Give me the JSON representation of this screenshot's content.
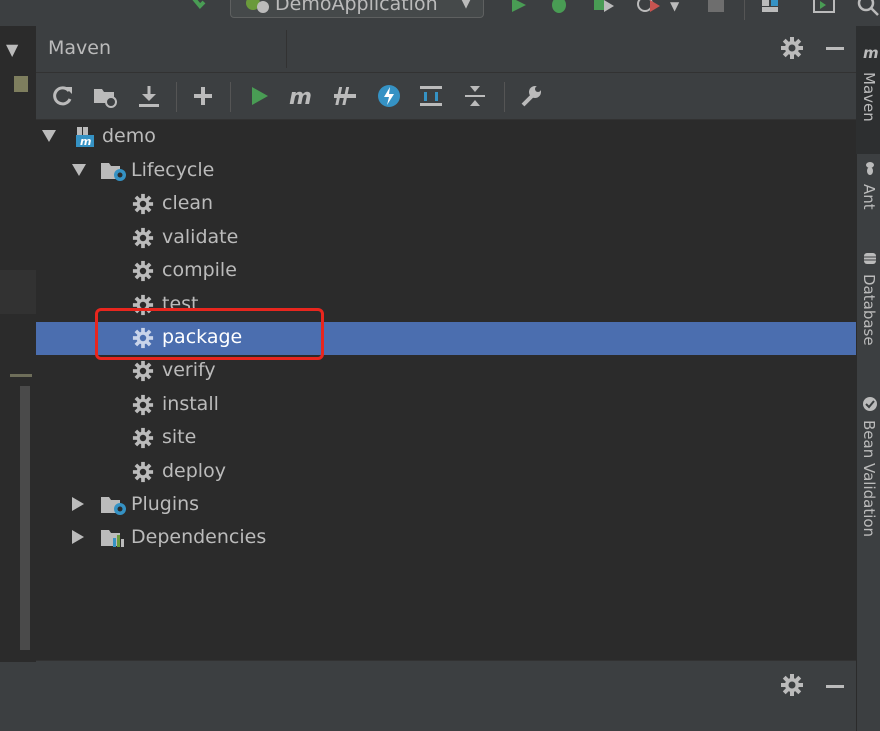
{
  "run_config": {
    "label": "DemoApplication"
  },
  "panel": {
    "title": "Maven"
  },
  "tree": {
    "root": "demo",
    "lifecycle": "Lifecycle",
    "phases": [
      "clean",
      "validate",
      "compile",
      "test",
      "package",
      "verify",
      "install",
      "site",
      "deploy"
    ],
    "selected": "package",
    "plugins": "Plugins",
    "dependencies": "Dependencies"
  },
  "right_tabs": [
    "Maven",
    "Ant",
    "Database",
    "Bean Validation"
  ],
  "colors": {
    "selection": "#4b6eaf",
    "highlight_box": "#e8261e",
    "run_green": "#499c54",
    "accent_blue": "#3592c4"
  },
  "icons": [
    "refresh-icon",
    "reimport-folder-icon",
    "download-icon",
    "add-icon",
    "run-icon",
    "maven-m-icon",
    "toggle-offline-icon",
    "skip-tests-icon",
    "show-dependencies-icon",
    "collapse-all-icon",
    "settings-wrench-icon",
    "gear-icon",
    "minimize-icon"
  ]
}
